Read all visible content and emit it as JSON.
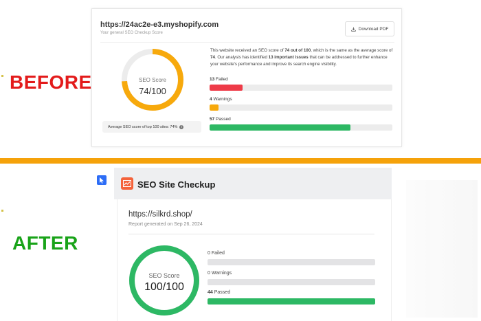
{
  "labels": {
    "before": "BEFORE",
    "after": "AFTER"
  },
  "colors": {
    "before_label": "#e31b1b",
    "after_label": "#19a319",
    "divider": "#f5a20a",
    "score_before": "#f7a90c",
    "score_after": "#2db864",
    "failed": "#ee3b48",
    "warnings": "#f7a90c",
    "passed": "#2db864"
  },
  "before": {
    "url": "https://24ac2e-e3.myshopify.com",
    "subtitle": "Your general SEO Checkup Score",
    "download_button": {
      "label": "Download PDF",
      "icon": "download-icon"
    },
    "score_label": "SEO Score",
    "score_value": "74/100",
    "score_fraction": 0.74,
    "avg_text": "Average SEO score of top 100 sites: 74%",
    "avg_icon": "info-icon",
    "description": {
      "p1": "This website received an SEO score of ",
      "b1": "74 out of 100",
      "p2": ", which is the same as the average score of ",
      "b2": "74",
      "p3": ". Our analysis has identified ",
      "b3": "13 important issues",
      "p4": " that can be addressed to further enhance your website's performance and improve its search engine visibility."
    },
    "stats": [
      {
        "count": "13",
        "label": "Failed",
        "fraction": 0.18
      },
      {
        "count": "4",
        "label": "Warnings",
        "fraction": 0.05
      },
      {
        "count": "57",
        "label": "Passed",
        "fraction": 0.77
      }
    ]
  },
  "after": {
    "app_title": "SEO Site Checkup",
    "app_icon": "seo-checkup-logo-icon",
    "cursor_icon": "cursor-icon",
    "url": "https://silkrd.shop/",
    "report_date": "Report generated on Sep 26, 2024",
    "score_label": "SEO Score",
    "score_value": "100/100",
    "score_fraction": 1.0,
    "stats": [
      {
        "count": "0",
        "label": "Failed",
        "fraction": 0
      },
      {
        "count": "0",
        "label": "Warnings",
        "fraction": 0
      },
      {
        "count": "44",
        "label": "Passed",
        "fraction": 1.0
      }
    ]
  }
}
